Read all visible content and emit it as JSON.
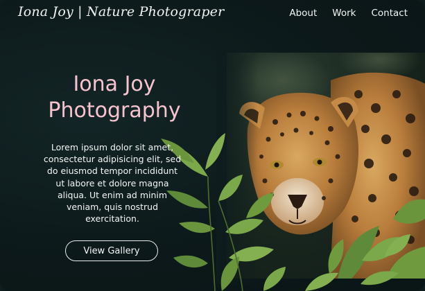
{
  "header": {
    "brand": "Iona Joy | Nature Photograper",
    "nav": [
      {
        "label": "About"
      },
      {
        "label": "Work"
      },
      {
        "label": "Contact"
      }
    ]
  },
  "hero": {
    "title_line1": "Iona Joy",
    "title_line2": "Photography",
    "description": "Lorem ipsum dolor sit amet, consectetur adipisicing elit, sed do eiusmod tempor incididunt ut labore et dolore magna aliqua. Ut enim ad minim veniam, quis nostrud exercitation.",
    "cta_label": "View Gallery"
  },
  "colors": {
    "background": "#0e1c1d",
    "title_pink": "#f7c3cf",
    "text": "#f4f6f5",
    "leaf_green": "#6f9a3e"
  },
  "image": {
    "subject_icon": "jaguar-photo"
  }
}
